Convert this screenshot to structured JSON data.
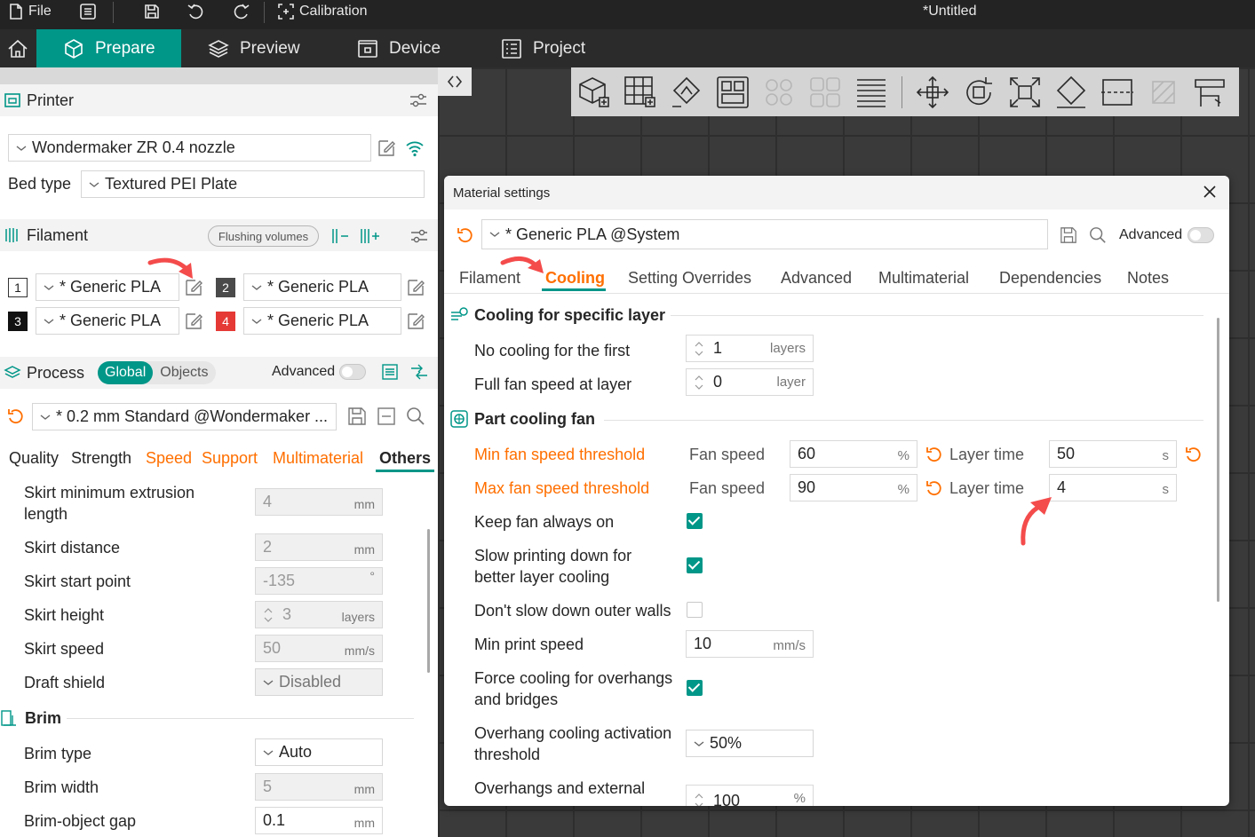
{
  "titlebar": {
    "file_label": "File",
    "calibration_label": "Calibration",
    "document_title": "*Untitled"
  },
  "nav": {
    "prepare": "Prepare",
    "preview": "Preview",
    "device": "Device",
    "project": "Project"
  },
  "printer": {
    "section_title": "Printer",
    "selected_printer": "Wondermaker ZR 0.4 nozzle",
    "bed_type_label": "Bed type",
    "bed_type_value": "Textured PEI Plate"
  },
  "filament": {
    "section_title": "Filament",
    "flushing_button": "Flushing volumes",
    "slots": [
      {
        "num": "1",
        "name": "* Generic PLA",
        "badge_color": "#ffffff",
        "badge_text_color": "#222222"
      },
      {
        "num": "2",
        "name": "* Generic PLA",
        "badge_color": "#4a4a4a",
        "badge_text_color": "#ffffff"
      },
      {
        "num": "3",
        "name": "* Generic PLA",
        "badge_color": "#111111",
        "badge_text_color": "#ffffff"
      },
      {
        "num": "4",
        "name": "* Generic PLA",
        "badge_color": "#e53935",
        "badge_text_color": "#ffffff"
      }
    ]
  },
  "process": {
    "section_title": "Process",
    "global_label": "Global",
    "objects_label": "Objects",
    "advanced_label": "Advanced",
    "preset": "* 0.2 mm  Standard @Wondermaker ...",
    "tabs": [
      "Quality",
      "Strength",
      "Speed",
      "Support",
      "Multimaterial",
      "Others"
    ],
    "active_tab": "Others",
    "rows": [
      {
        "label": "Skirt minimum extrusion",
        "label2": "length",
        "value": "4",
        "unit": "mm"
      },
      {
        "label": "Skirt distance",
        "value": "2",
        "unit": "mm"
      },
      {
        "label": "Skirt start point",
        "value": "-135",
        "unit": "°"
      },
      {
        "label": "Skirt height",
        "value": "3",
        "unit": "layers"
      },
      {
        "label": "Skirt speed",
        "value": "50",
        "unit": "mm/s"
      },
      {
        "label": "Draft shield",
        "value": "Disabled",
        "unit": ""
      }
    ],
    "brim_title": "Brim",
    "brim_rows": [
      {
        "label": "Brim type",
        "value": "Auto",
        "unit": ""
      },
      {
        "label": "Brim width",
        "value": "5",
        "unit": "mm"
      },
      {
        "label": "Brim-object gap",
        "value": "0.1",
        "unit": "mm"
      }
    ]
  },
  "dialog": {
    "title": "Material settings",
    "preset": "* Generic PLA @System",
    "advanced_label": "Advanced",
    "tabs": [
      "Filament",
      "Cooling",
      "Setting Overrides",
      "Advanced",
      "Multimaterial",
      "Dependencies",
      "Notes"
    ],
    "active_tab": "Cooling",
    "group1_title": "Cooling for specific layer",
    "no_cooling_label": "No cooling for the first",
    "no_cooling_value": "1",
    "no_cooling_unit": "layers",
    "full_fan_label": "Full fan speed at layer",
    "full_fan_value": "0",
    "full_fan_unit": "layer",
    "group2_title": "Part cooling fan",
    "min_fan_label": "Min fan speed threshold",
    "max_fan_label": "Max fan speed threshold",
    "fan_speed_label": "Fan speed",
    "layer_time_label": "Layer time",
    "min_fan_speed": "60",
    "min_layer_time": "50",
    "max_fan_speed": "90",
    "max_layer_time": "4",
    "percent_unit": "%",
    "seconds_unit": "s",
    "keep_fan_label": "Keep fan always on",
    "keep_fan_checked": true,
    "slow_print_label": "Slow printing down for",
    "slow_print_label2": "better layer cooling",
    "slow_print_checked": true,
    "dont_slow_label": "Don't slow down outer walls",
    "dont_slow_checked": false,
    "min_print_speed_label": "Min print speed",
    "min_print_speed_value": "10",
    "min_print_speed_unit": "mm/s",
    "force_cooling_label": "Force cooling for overhangs",
    "force_cooling_label2": "and bridges",
    "force_cooling_checked": true,
    "overhang_threshold_label": "Overhang cooling activation",
    "overhang_threshold_label2": "threshold",
    "overhang_threshold_value": "50%",
    "overhangs_ext_label": "Overhangs and external",
    "overhangs_ext_value": "100",
    "overhangs_ext_unit": "%"
  },
  "colors": {
    "accent": "#009688",
    "highlight_text": "#ff6f00",
    "annotation_arrow": "#f44b4b"
  }
}
